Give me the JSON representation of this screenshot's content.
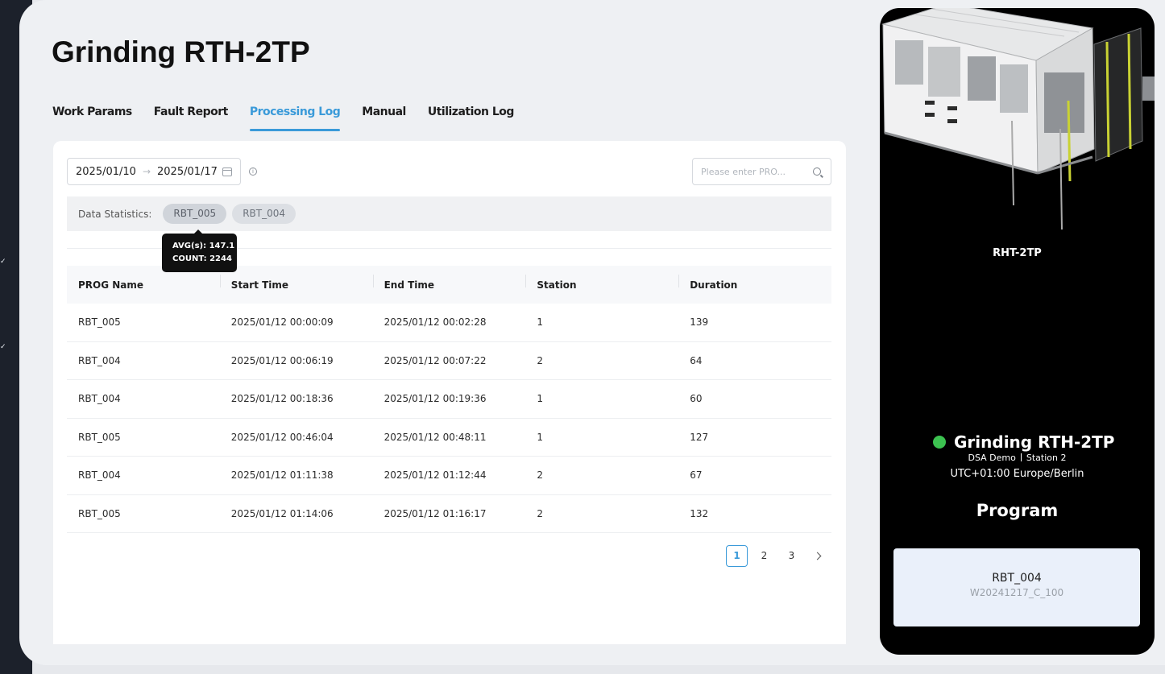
{
  "page_title": "Grinding RTH-2TP",
  "tabs": [
    {
      "label": "Work Params",
      "active": false
    },
    {
      "label": "Fault Report",
      "active": false
    },
    {
      "label": "Processing Log",
      "active": true
    },
    {
      "label": "Manual",
      "active": false
    },
    {
      "label": "Utilization Log",
      "active": false
    }
  ],
  "filters": {
    "start_date": "2025/01/10",
    "end_date": "2025/01/17",
    "search_placeholder": "Please enter PRO..."
  },
  "stats": {
    "label": "Data Statistics:",
    "chips": [
      "RBT_005",
      "RBT_004"
    ],
    "tooltip": {
      "avg": "AVG(s): 147.1",
      "count": "COUNT: 2244"
    }
  },
  "table": {
    "headers": [
      "PROG Name",
      "Start Time",
      "End Time",
      "Station",
      "Duration"
    ],
    "rows": [
      [
        "RBT_005",
        "2025/01/12 00:00:09",
        "2025/01/12 00:02:28",
        "1",
        "139"
      ],
      [
        "RBT_004",
        "2025/01/12 00:06:19",
        "2025/01/12 00:07:22",
        "2",
        "64"
      ],
      [
        "RBT_004",
        "2025/01/12 00:18:36",
        "2025/01/12 00:19:36",
        "1",
        "60"
      ],
      [
        "RBT_005",
        "2025/01/12 00:46:04",
        "2025/01/12 00:48:11",
        "1",
        "127"
      ],
      [
        "RBT_004",
        "2025/01/12 01:11:38",
        "2025/01/12 01:12:44",
        "2",
        "67"
      ],
      [
        "RBT_005",
        "2025/01/12 01:14:06",
        "2025/01/12 01:16:17",
        "2",
        "132"
      ]
    ]
  },
  "pagination": {
    "pages": [
      "1",
      "2",
      "3"
    ],
    "current": "1"
  },
  "machine_panel": {
    "image_label": "RHT-2TP",
    "name": "Grinding RTH-2TP",
    "status_color": "#3cc250",
    "org": "DSA Demo",
    "station": "Station 2",
    "timezone": "UTC+01:00 Europe/Berlin",
    "program_heading": "Program",
    "program_name": "RBT_004",
    "program_code": "W20241217_C_100"
  },
  "colors": {
    "accent": "#3a9ad9",
    "rail": "#1c212b",
    "panel": "#000000"
  }
}
